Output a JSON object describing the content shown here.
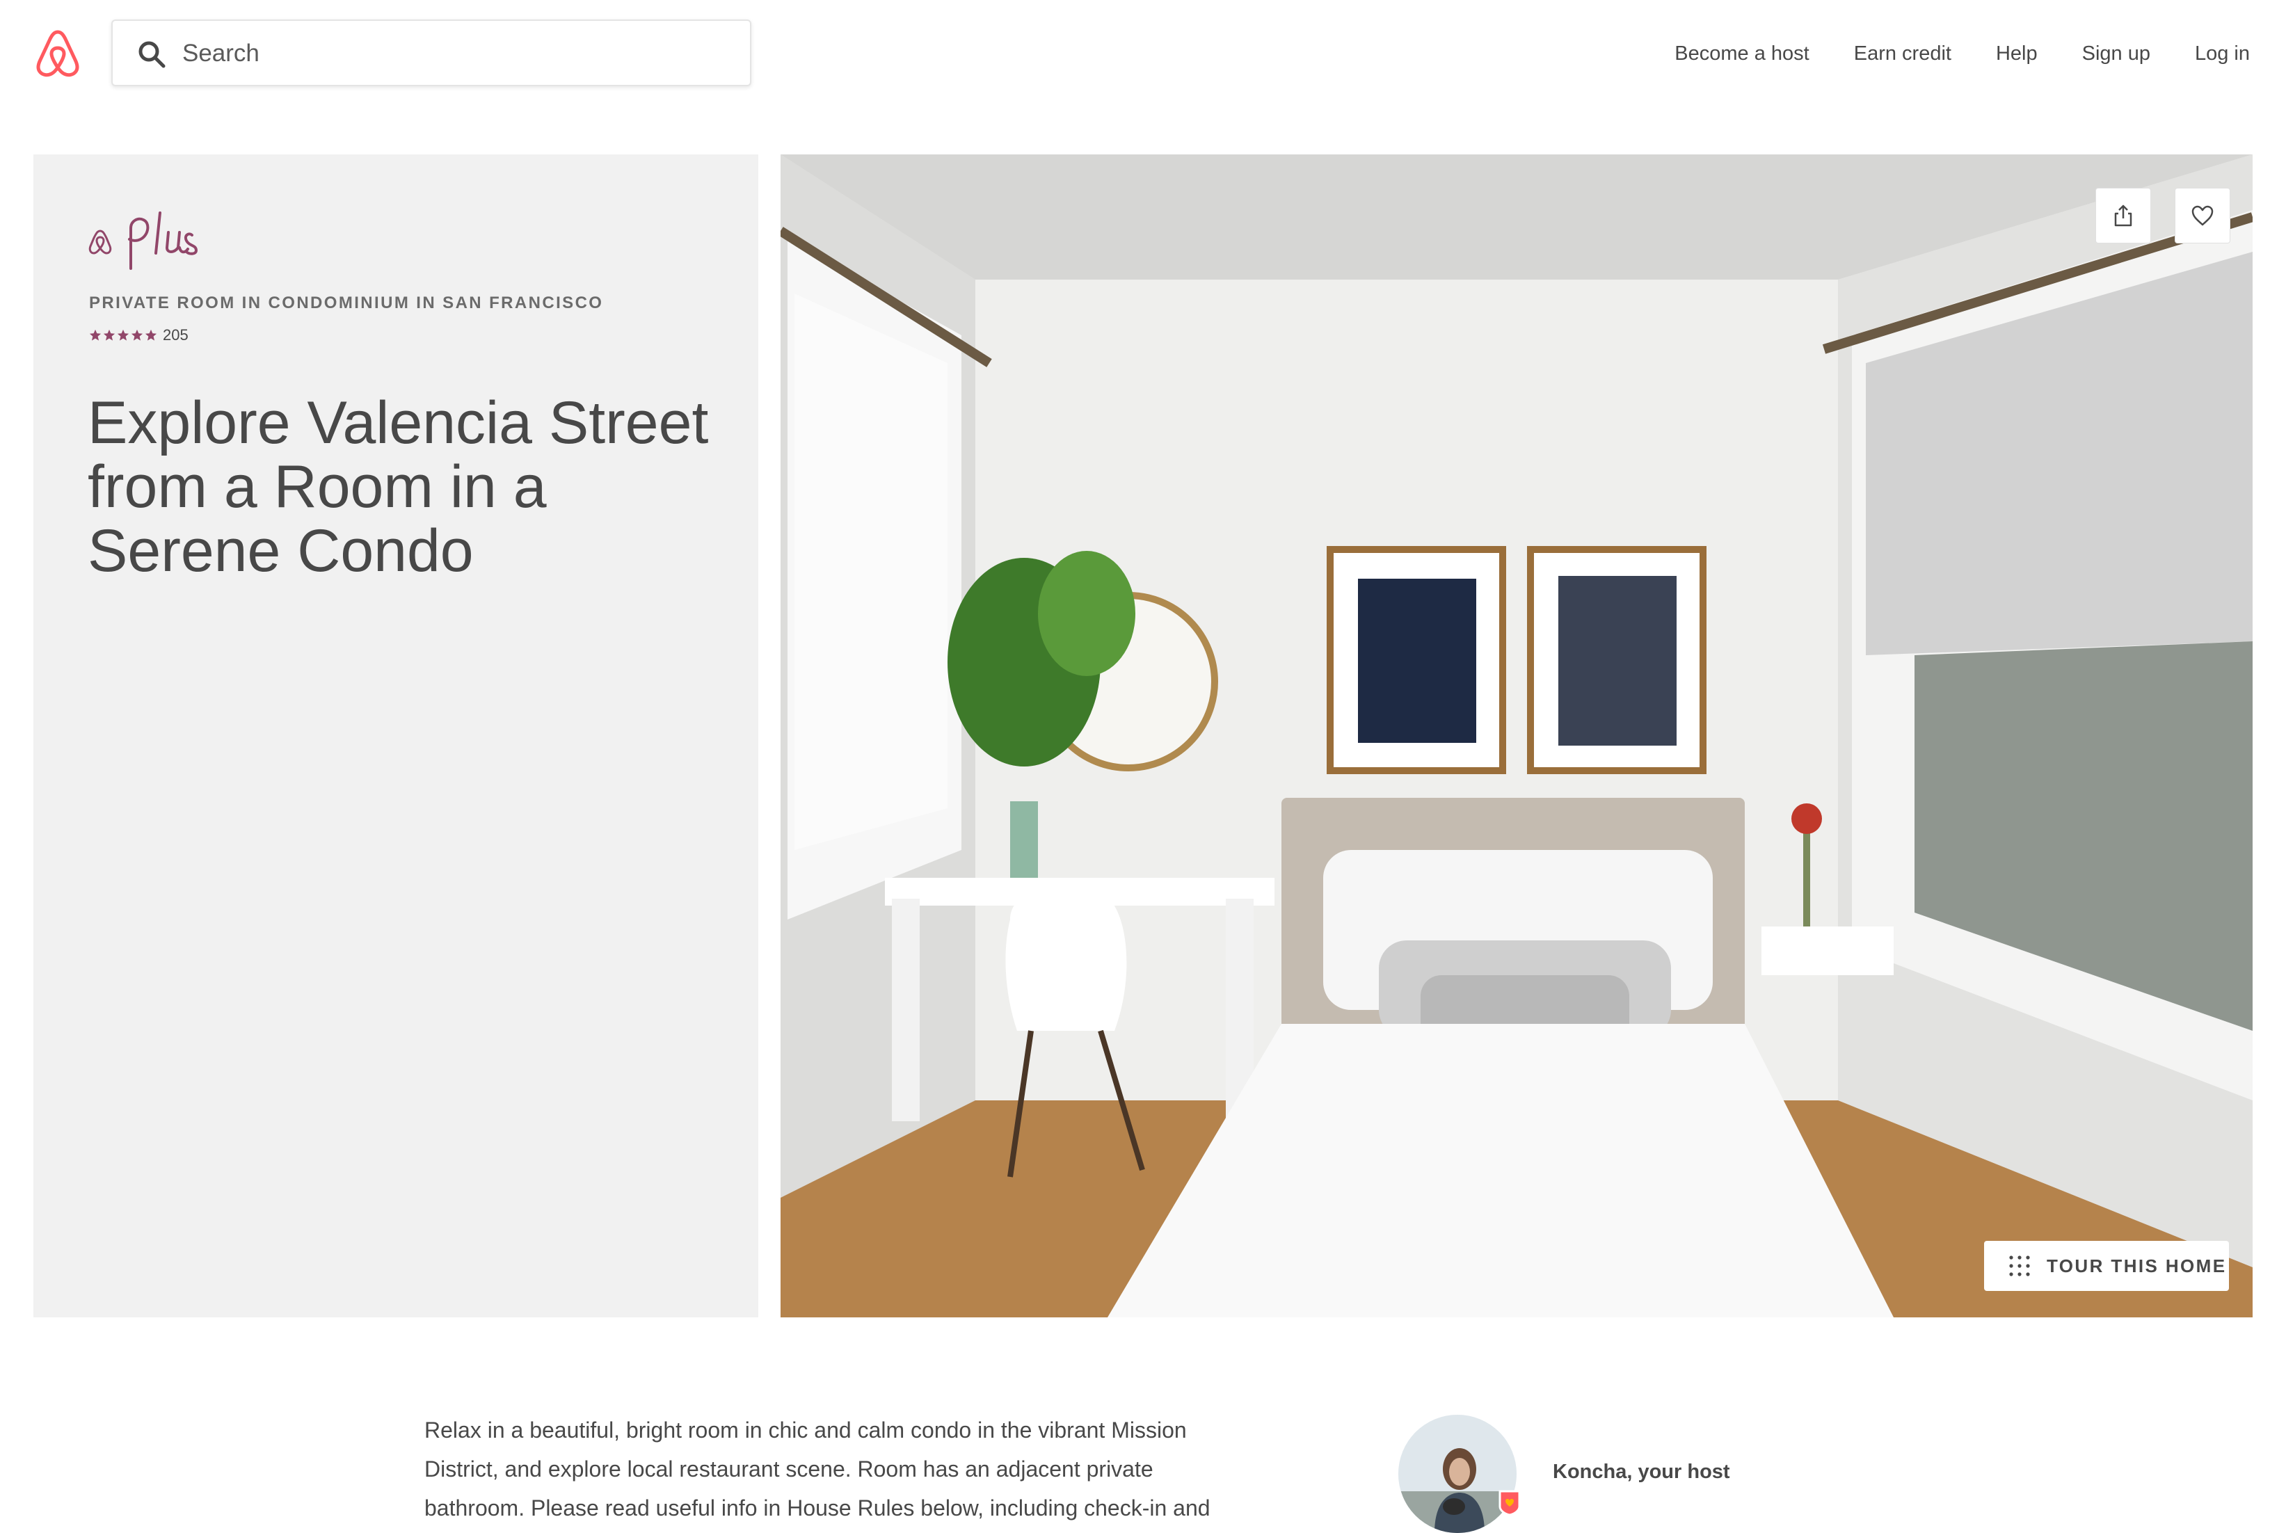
{
  "header": {
    "search_placeholder": "Search",
    "nav": [
      "Become a host",
      "Earn credit",
      "Help",
      "Sign up",
      "Log in"
    ]
  },
  "listing": {
    "category": "PRIVATE ROOM IN CONDOMINIUM IN SAN FRANCISCO",
    "rating_stars": 5,
    "review_count": "205",
    "title": "Explore Valencia Street from a Room in a Serene Condo",
    "tour_button": "TOUR THIS HOME",
    "description": "Relax in a beautiful, bright room in chic and calm condo in the vibrant Mission District, and explore local restaurant scene. Room has an adjacent private bathroom. Please read useful info in House Rules below, including check-in and",
    "host_name": "Koncha, your host"
  },
  "colors": {
    "brand": "#FF5A5F",
    "plus": "#914669",
    "text": "#484848",
    "panel": "#F1F1F1"
  }
}
